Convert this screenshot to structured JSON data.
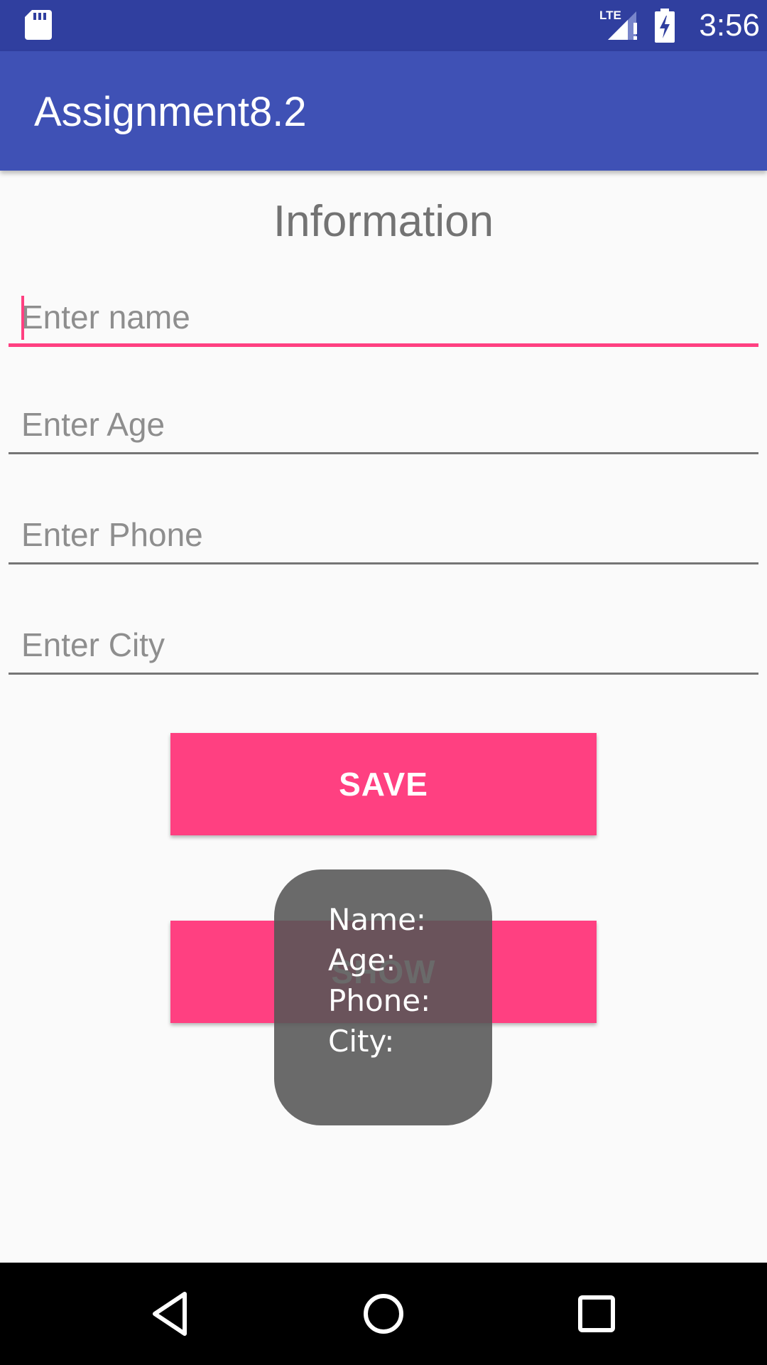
{
  "status_bar": {
    "time": "3:56",
    "network_label": "LTE",
    "icons": [
      "sd-card-icon",
      "lte-signal-icon",
      "battery-charging-icon"
    ]
  },
  "app_bar": {
    "title": "Assignment8.2"
  },
  "form": {
    "heading": "Information",
    "fields": [
      {
        "placeholder": "Enter name",
        "value": "",
        "focused": true
      },
      {
        "placeholder": "Enter Age",
        "value": ""
      },
      {
        "placeholder": "Enter Phone",
        "value": ""
      },
      {
        "placeholder": "Enter City",
        "value": ""
      }
    ],
    "save_label": "SAVE",
    "show_label": "SHOW"
  },
  "toast": {
    "lines": [
      "Name:",
      "Age:",
      "Phone:",
      "City:"
    ]
  },
  "nav_bar": {
    "icons": [
      "back-icon",
      "home-icon",
      "recents-icon"
    ]
  },
  "colors": {
    "status_bar": "#303f9f",
    "app_bar": "#3f51b5",
    "accent": "#ff4081",
    "background": "#fafafa",
    "toast": "#555555"
  }
}
